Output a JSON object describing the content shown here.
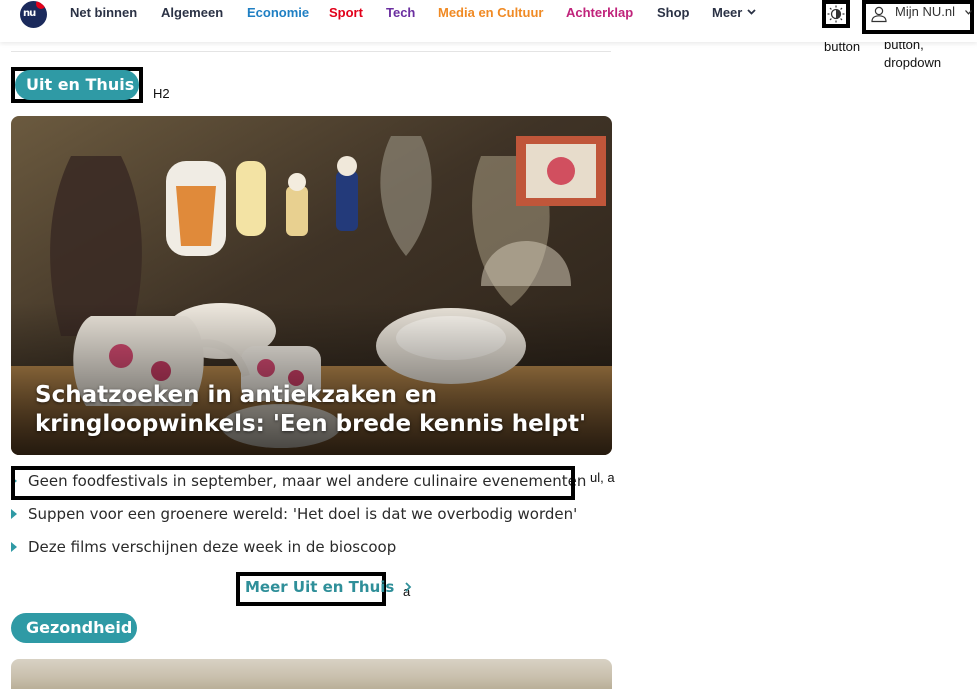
{
  "colors": {
    "accent": "#2f9aa5",
    "logo_navy": "#1b2a5c",
    "logo_red": "#e2001a"
  },
  "header": {
    "logo_icon": "nu-logo-icon",
    "nav": [
      {
        "label": "Net binnen",
        "color": "#2b3245"
      },
      {
        "label": "Algemeen",
        "color": "#2b3245"
      },
      {
        "label": "Economie",
        "color": "#1f7fc3"
      },
      {
        "label": "Sport",
        "color": "#e2001a"
      },
      {
        "label": "Tech",
        "color": "#6b2fa0"
      },
      {
        "label": "Media en Cultuur",
        "color": "#f08a24"
      },
      {
        "label": "Achterklap",
        "color": "#c0237b"
      },
      {
        "label": "Shop",
        "color": "#2b3245"
      },
      {
        "label": "Meer",
        "color": "#2b3245",
        "icon": "chevron-down-icon"
      }
    ],
    "theme_toggle_icon": "brightness-icon",
    "account": {
      "label": "Mijn NU.nl",
      "icon": "user-icon",
      "dropdown_icon": "chevron-down-icon"
    }
  },
  "annotations": {
    "theme": "button",
    "account_line1": "button,",
    "account_line2": "dropdown",
    "heading": "H2",
    "list": "ul, a",
    "link": "a"
  },
  "section": {
    "heading": "Uit en Thuis",
    "hero_title": "Schatzoeken in antiekzaken en kringloopwinkels: 'Een brede kennis helpt'",
    "articles": [
      "Geen foodfestivals in september, maar wel andere culinaire evenementen",
      "Suppen voor een groenere wereld: 'Het doel is dat we overbodig worden'",
      "Deze films verschijnen deze week in de bioscoop"
    ],
    "more_link": "Meer Uit en Thuis",
    "more_icon": "chevron-right-icon"
  },
  "next_section": {
    "heading": "Gezondheid"
  }
}
